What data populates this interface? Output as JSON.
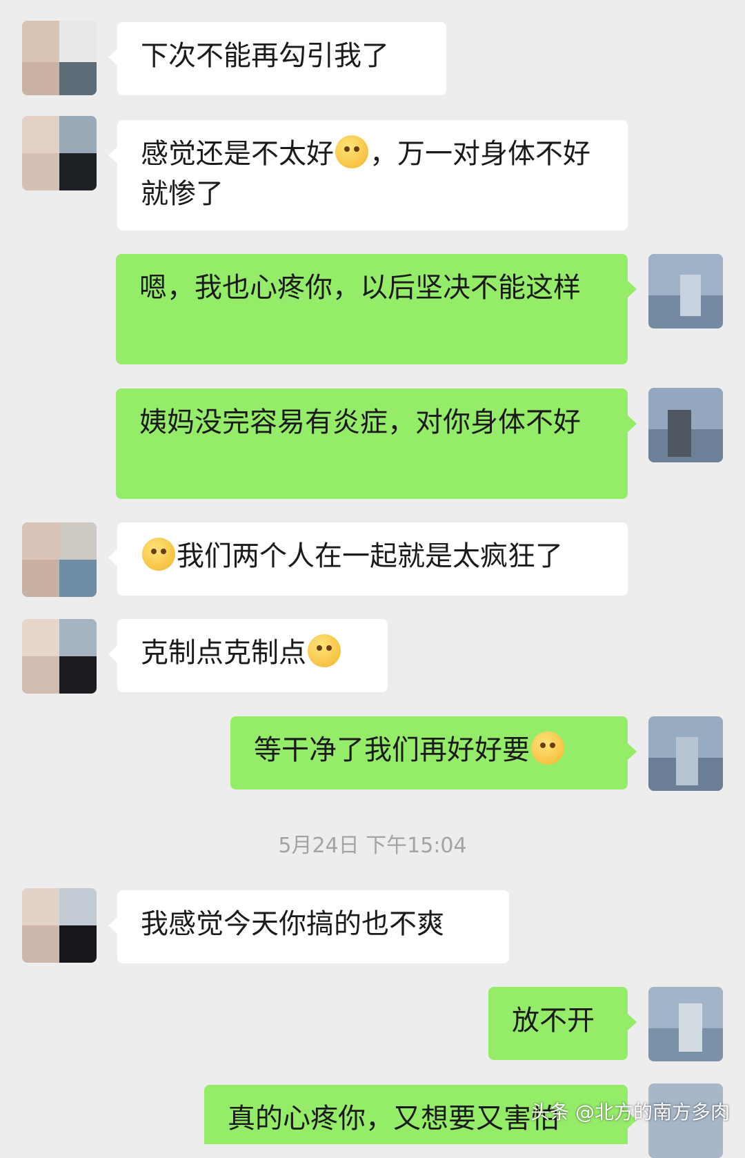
{
  "messages": [
    {
      "side": "in",
      "text": "下次不能再勾引我了"
    },
    {
      "side": "in",
      "text_a": "感觉还是不太好",
      "emoji": "tears-of-joy-emoji",
      "text_b": "，万一对身体不好就惨了"
    },
    {
      "side": "out",
      "text": "嗯，我也心疼你，以后坚决不能这样"
    },
    {
      "side": "out",
      "text": "姨妈没完容易有炎症，对你身体不好"
    },
    {
      "side": "in",
      "emoji": "face-with-hand-over-mouth-emoji",
      "text": "我们两个人在一起就是太疯狂了"
    },
    {
      "side": "in",
      "text": "克制点克制点",
      "emoji": "dizzy-face-emoji"
    },
    {
      "side": "out",
      "text": "等干净了我们再好好要",
      "emoji": "grinning-squinting-emoji"
    },
    {
      "side": "in",
      "text": "我感觉今天你搞的也不爽"
    },
    {
      "side": "out",
      "text": "放不开"
    },
    {
      "side": "out",
      "text": "真的心疼你，又想要又害怕"
    }
  ],
  "timestamp": "5月24日 下午15:04",
  "watermark": "头条 @北方的南方多肉",
  "colors": {
    "background": "#ededed",
    "incoming_bubble": "#ffffff",
    "outgoing_bubble": "#95ec69",
    "timestamp_text": "#a3a3a3"
  }
}
